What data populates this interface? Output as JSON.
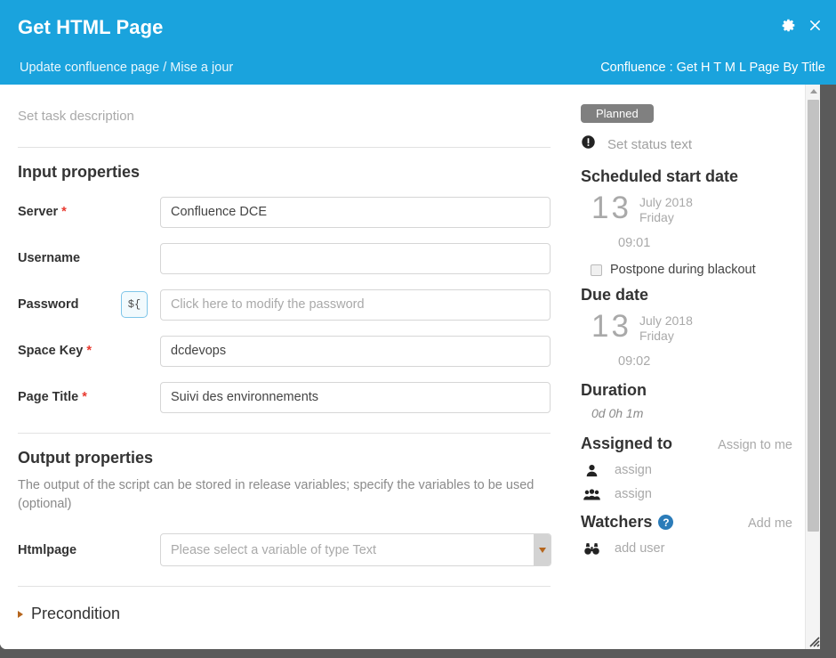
{
  "titlebar": {
    "title": "Get HTML Page",
    "subtitle": "Update confluence page / Mise a jour",
    "breadcrumb": "Confluence : Get H T M L Page By Title",
    "settings_icon": "gear-icon",
    "close_icon": "close-icon",
    "background_color": "#1aa3dd"
  },
  "form": {
    "task_description_placeholder": "Set task description",
    "input_section_title": "Input properties",
    "output_section_title": "Output properties",
    "output_section_desc": "The output of the script can be stored in release variables; specify the variables to be used (optional)",
    "variable_button_label": "${",
    "fields": [
      {
        "label": "Server",
        "required": true,
        "value": "Confluence DCE",
        "placeholder": ""
      },
      {
        "label": "Username",
        "required": false,
        "value": "",
        "placeholder": ""
      },
      {
        "label": "Password",
        "required": false,
        "value": "",
        "placeholder": "Click here to modify the password"
      },
      {
        "label": "Space Key",
        "required": true,
        "value": "dcdevops",
        "placeholder": ""
      },
      {
        "label": "Page Title",
        "required": true,
        "value": "Suivi des environnements",
        "placeholder": ""
      }
    ],
    "output_field": {
      "label": "Htmlpage",
      "placeholder": "Please select a variable of type Text",
      "value": ""
    },
    "precondition_label": "Precondition"
  },
  "sidebar": {
    "status_badge": "Planned",
    "status_badge_color": "#808080",
    "status_text_placeholder": "Set status text",
    "scheduled_start": {
      "heading": "Scheduled start date",
      "day": "13",
      "month_year": "July 2018",
      "weekday": "Friday",
      "time": "09:01"
    },
    "postpone_label": "Postpone during blackout",
    "postpone_checked": false,
    "due_date": {
      "heading": "Due date",
      "day": "13",
      "month_year": "July 2018",
      "weekday": "Friday",
      "time": "09:02"
    },
    "duration": {
      "heading": "Duration",
      "value": "0d 0h 1m"
    },
    "assigned": {
      "heading": "Assigned to",
      "action": "Assign to me",
      "user_label": "assign",
      "team_label": "assign"
    },
    "watchers": {
      "heading": "Watchers",
      "action": "Add me",
      "add_label": "add user",
      "help_glyph": "?"
    }
  }
}
